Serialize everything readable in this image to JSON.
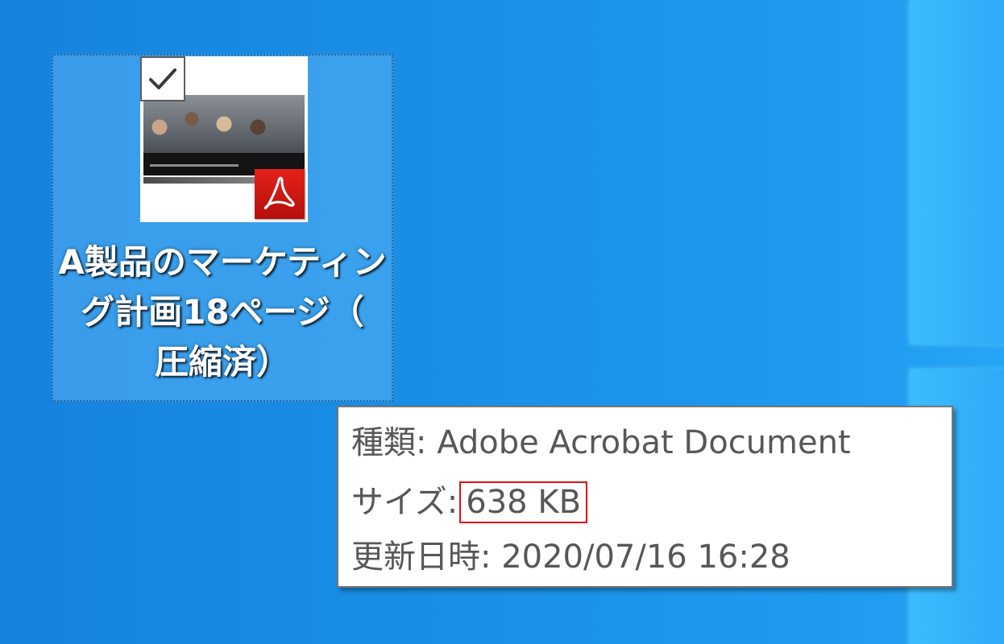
{
  "desktop": {
    "background": "#1a8fe6",
    "accent": "#3bbcff"
  },
  "file_icon": {
    "label": "A製品のマーケティング計画18ページ（圧縮済）",
    "label_lines": [
      "A製品のマーケティン",
      "グ計画18ページ（",
      "圧縮済）"
    ],
    "selected": true,
    "checked": true,
    "thumbnail_icon": "pdf-document-thumbnail",
    "badge_icon": "adobe-acrobat-icon",
    "badge_color": "#e3221a"
  },
  "tooltip": {
    "type_label": "種類:",
    "type_value": "Adobe Acrobat Document",
    "size_label": "サイズ:",
    "size_value": "638 KB",
    "modified_label": "更新日時:",
    "modified_value": "2020/07/16 16:28",
    "highlight_color": "#e01010"
  }
}
